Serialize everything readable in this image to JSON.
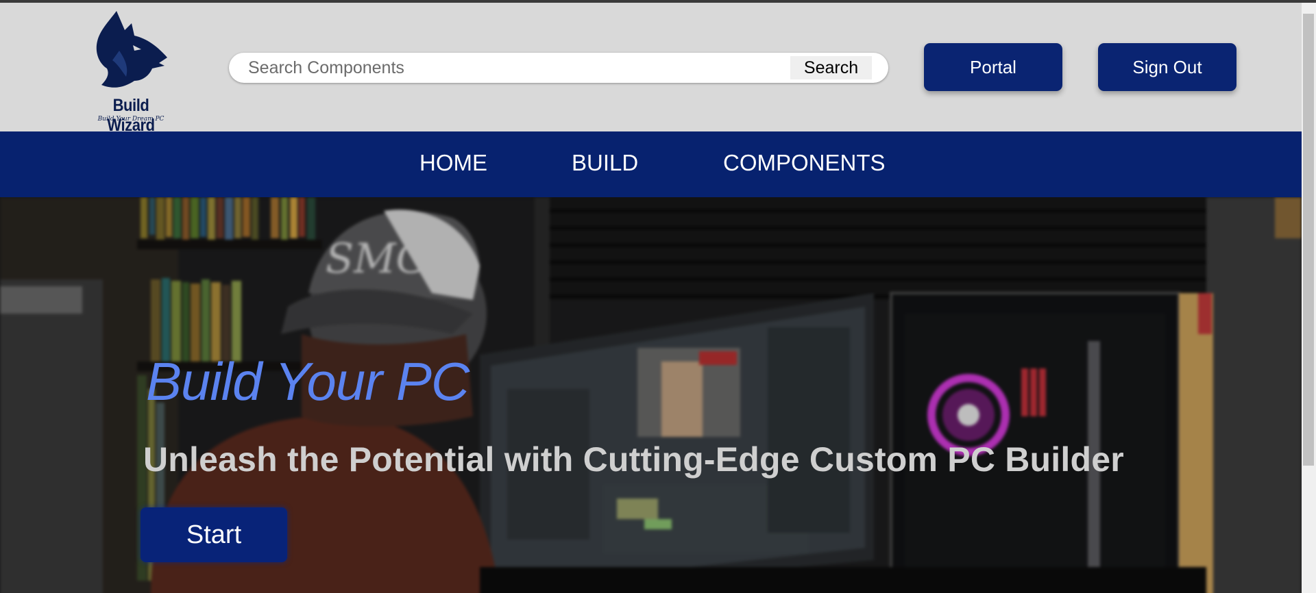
{
  "logo": {
    "name": "Build Wizard",
    "tagline": "Build Your Dream PC",
    "icon": "wolf-icon"
  },
  "search": {
    "placeholder": "Search Components",
    "value": "",
    "button_label": "Search"
  },
  "header_buttons": {
    "portal": "Portal",
    "sign_out": "Sign Out"
  },
  "nav": {
    "items": [
      {
        "label": "HOME"
      },
      {
        "label": "BUILD"
      },
      {
        "label": "COMPONENTS"
      }
    ]
  },
  "hero": {
    "title": "Build Your PC",
    "subtitle": "Unleash the Potential with Cutting-Edge Custom PC Builder",
    "cta_label": "Start",
    "cap_text": "SMG"
  },
  "colors": {
    "brand_blue": "#07226f",
    "title_blue": "#5b83f0",
    "header_bg": "#d9d9d9"
  }
}
